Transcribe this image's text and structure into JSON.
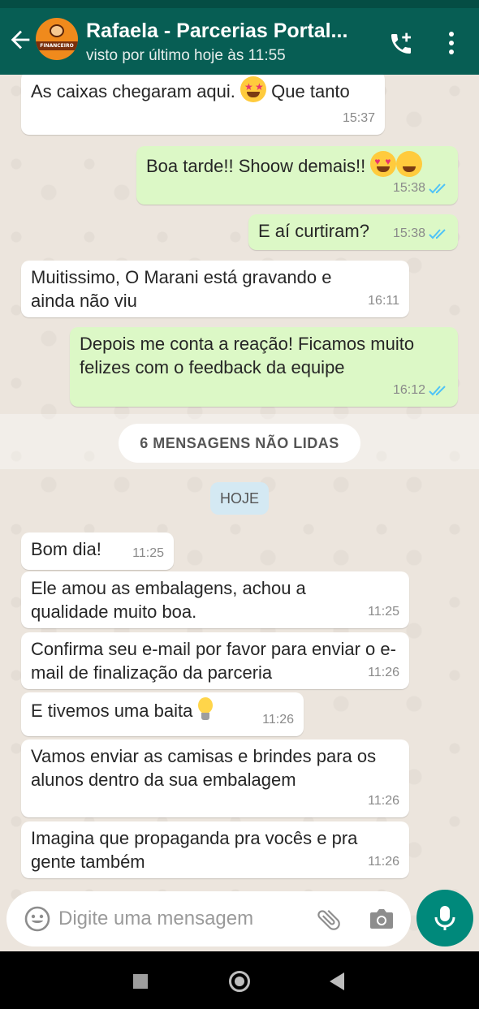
{
  "header": {
    "contact_name": "Rafaela - Parcerias Portal...",
    "status": "visto por último hoje às 11:55",
    "avatar_text": "FINANCEIRO"
  },
  "messages_before": [
    {
      "text": "As caixas chegaram aqui.",
      "text_after": "Que tanto",
      "time": "15:37",
      "direction": "in"
    },
    {
      "text": "Boa tarde!! Shoow demais!!",
      "time": "15:38",
      "direction": "out",
      "read": true
    },
    {
      "text": "E aí curtiram?",
      "time": "15:38",
      "direction": "out",
      "read": true
    },
    {
      "text": "Muitissimo, O Marani está gravando e ainda não viu",
      "time": "16:11",
      "direction": "in"
    },
    {
      "text": "Depois me conta a reação! Ficamos muito felizes com o feedback da equipe",
      "time": "16:12",
      "direction": "out",
      "read": true
    }
  ],
  "unread_label": "6 MENSAGENS NÃO LIDAS",
  "date_label": "HOJE",
  "messages_today": [
    {
      "text": "Bom dia!",
      "time": "11:25",
      "direction": "in"
    },
    {
      "text": "Ele amou as embalagens, achou a qualidade muito boa.",
      "time": "11:25",
      "direction": "in"
    },
    {
      "text": "Confirma seu e-mail por favor para enviar o e-mail de finalização da parceria",
      "time": "11:26",
      "direction": "in"
    },
    {
      "text": "E tivemos uma baita",
      "time": "11:26",
      "direction": "in"
    },
    {
      "text": "Vamos enviar as camisas e brindes para os alunos dentro da sua embalagem",
      "time": "11:26",
      "direction": "in"
    },
    {
      "text": "Imagina que propaganda pra vocês e pra gente também",
      "time": "11:26",
      "direction": "in"
    }
  ],
  "composer": {
    "placeholder": "Digite uma mensagem"
  },
  "colors": {
    "header": "#075e54",
    "accent": "#00897b",
    "outgoing": "#dcf8c6",
    "incoming": "#ffffff",
    "read_ticks": "#4fc3f7"
  },
  "icons": [
    "back-arrow-icon",
    "add-call-icon",
    "more-vert-icon",
    "smiley-icon",
    "attach-clip-icon",
    "camera-icon",
    "mic-icon",
    "star-struck-emoji",
    "heart-eyes-emoji",
    "party-emoji",
    "light-bulb-emoji",
    "double-check-icon",
    "nav-recents-icon",
    "nav-home-icon",
    "nav-back-icon"
  ]
}
